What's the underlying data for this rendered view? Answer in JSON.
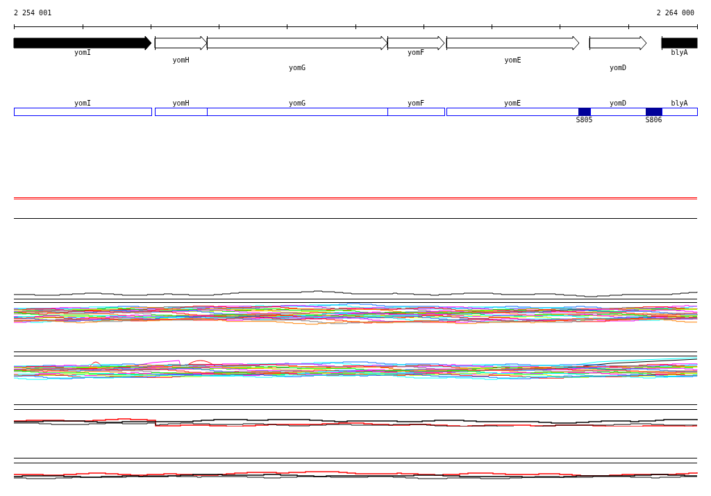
{
  "ruler": {
    "start": "2 254 001",
    "end": "2 264 000"
  },
  "genes": [
    {
      "name": "yomI",
      "kind": "arrow",
      "filled": true
    },
    {
      "name": "yomH",
      "kind": "arrow",
      "filled": false
    },
    {
      "name": "yomG",
      "kind": "arrow",
      "filled": false
    },
    {
      "name": "yomF",
      "kind": "arrow",
      "filled": false
    },
    {
      "name": "yomE",
      "kind": "arrow",
      "filled": false
    },
    {
      "name": "yomD",
      "kind": "arrow",
      "filled": false
    },
    {
      "name": "blyA",
      "kind": "partial",
      "filled": true
    }
  ],
  "annotations": [
    {
      "name": "yomI"
    },
    {
      "name": "yomH"
    },
    {
      "name": "yomG"
    },
    {
      "name": "yomF"
    },
    {
      "name": "yomE"
    },
    {
      "name": "yomD"
    },
    {
      "name": "blyA"
    }
  ],
  "segments": [
    {
      "label": "S805"
    },
    {
      "label": "S806"
    }
  ]
}
